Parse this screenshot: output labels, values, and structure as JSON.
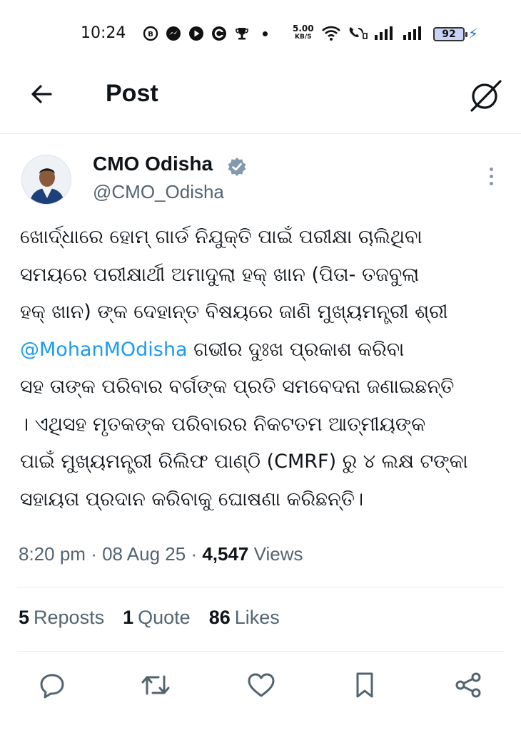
{
  "status_bar": {
    "time": "10:24",
    "net_speed_value": "5.00",
    "net_speed_unit": "KB/S",
    "battery": "92"
  },
  "header": {
    "title": "Post",
    "back_icon": "arrow-left-icon",
    "grok_icon": "grok-icon"
  },
  "post": {
    "author": {
      "name": "CMO Odisha",
      "handle": "@CMO_Odisha",
      "verified": true
    },
    "text_lines": [
      "ଖୋର୍ଦ୍ଧାରେ ହୋମ୍ ଗାର୍ଡ ନିଯୁକ୍ତି ପାଇଁ ପରୀକ୍ଷା ଚାଲିଥିବା",
      "ସମୟରେ ପରୀକ୍ଷାର୍ଥୀ ଅମାଦୁଲା ହକ୍ ଖାନ (ପିତା- ତଜବୁଲା",
      "ହକ୍ ଖାନ) ଙ୍କ ଦେହାନ୍ତ ବିଷୟରେ ଜାଣି ମୁଖ୍ୟମନ୍ତ୍ରୀ ଶ୍ରୀ",
      "",
      "ସହ ତାଙ୍କ ପରିବାର ବର୍ଗଙ୍କ ପ୍ରତି ସମବେଦନା ଜଣାଇଛନ୍ତି",
      "। ଏଥିସହ ମୃତକଙ୍କ ପରିବାରର ନିକଟତମ ଆତ୍ମୀୟଙ୍କ",
      "ପାଇଁ ମୁଖ୍ୟମନ୍ତ୍ରୀ ରିଲିଫ ପାଣ୍ଠି (CMRF) ରୁ ୪ ଲକ୍ଷ ଟଙ୍କା",
      "ସହାୟତା ପ୍ରଦାନ କରିବାକୁ ଘୋଷଣା କରିଛନ୍ତି।"
    ],
    "mention": "@MohanMOdisha",
    "mention_line_rest": " ଗଭୀର ଦୁଃଖ ପ୍ରକାଶ କରିବା",
    "time": "8:20 pm",
    "date": "08 Aug 25",
    "views_count": "4,547",
    "views_label": "Views",
    "reposts_count": "5",
    "reposts_label": "Reposts",
    "quotes_count": "1",
    "quotes_label": "Quote",
    "likes_count": "86",
    "likes_label": "Likes"
  },
  "actions": [
    "reply-icon",
    "repost-icon",
    "like-icon",
    "bookmark-icon",
    "share-icon"
  ]
}
